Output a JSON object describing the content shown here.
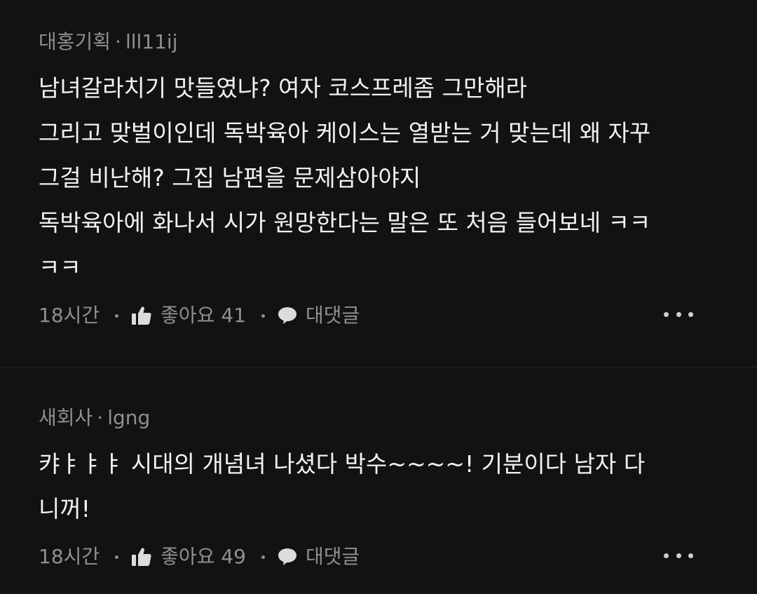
{
  "comments": [
    {
      "company": "대홍기획",
      "user": "lll11ij",
      "lines": [
        "남녀갈라치기 맛들였냐? 여자 코스프레좀 그만해라",
        "그리고 맞벌이인데 독박육아 케이스는 열받는 거 맞는데 왜 자꾸",
        "그걸 비난해? 그집 남편을 문제삼아야지",
        "독박육아에 화나서 시가 원망한다는 말은 또 처음 들어보네 ㅋㅋ",
        "ㅋㅋ"
      ],
      "time": "18시간",
      "like_label": "좋아요 41",
      "reply_label": "대댓글"
    },
    {
      "company": "새회사",
      "user": "lgng",
      "lines": [
        "캬ㅑㅑㅑ 시대의 개념녀 나셨다 박수~~~~! 기분이다 남자 다",
        "니꺼!"
      ],
      "time": "18시간",
      "like_label": "좋아요 49",
      "reply_label": "대댓글"
    }
  ],
  "icons": {
    "like": "thumbs-up-icon",
    "reply": "speech-bubble-icon",
    "more": "more-dots-icon"
  },
  "colors": {
    "background": "#121212",
    "meta": "#8f8f8f",
    "text": "#f2f2f2"
  }
}
